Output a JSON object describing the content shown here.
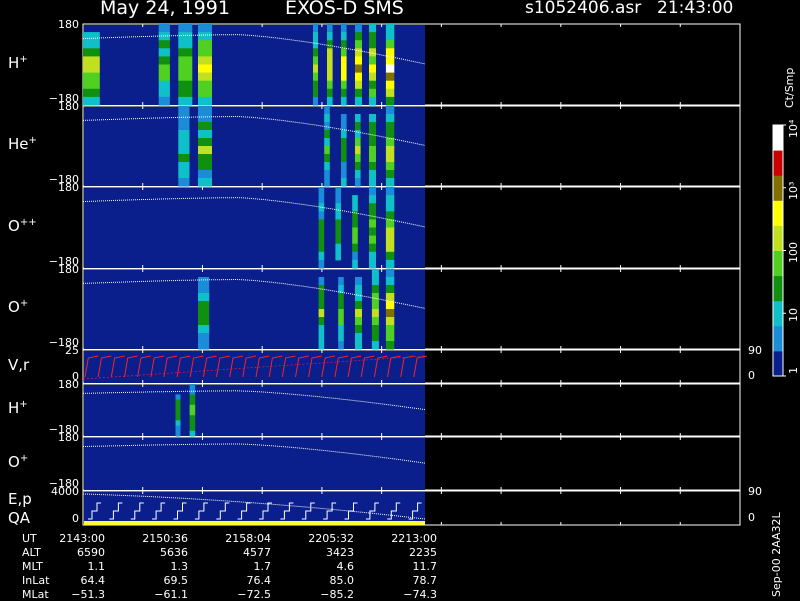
{
  "header": {
    "date_title": "May 24, 1991",
    "instrument": "EXOS-D SMS",
    "filename": "s1052406.asr",
    "time": "21:43:00"
  },
  "colors": {
    "background": "#000000",
    "panel_bg": "#0a1e8c",
    "axis": "#ffffff",
    "velocity_trace": "#ff2020",
    "energy_trace": "#ffffff",
    "qa_bar": "#ffff33"
  },
  "colorbar": {
    "unit": "Ct/Smp",
    "tick_labels": [
      "1",
      "10",
      "100",
      "10³",
      "10⁴"
    ],
    "tick_values": [
      1,
      10,
      100,
      1000,
      10000
    ],
    "colors": [
      "#0a1e8c",
      "#1a8cd8",
      "#10c0c8",
      "#109010",
      "#50d020",
      "#c0e020",
      "#ffff00",
      "#807000",
      "#cc0000",
      "#ffffff"
    ]
  },
  "panels": [
    {
      "label": "H",
      "sup": "+",
      "ymax": "180",
      "ymin": "−180"
    },
    {
      "label": "He",
      "sup": "+",
      "ymax": "180",
      "ymin": "−180"
    },
    {
      "label": "O",
      "sup": "++",
      "ymax": "180",
      "ymin": "−180"
    },
    {
      "label": "O",
      "sup": "+",
      "ymax": "180",
      "ymin": "−180"
    },
    {
      "label": "V,r",
      "sup": "",
      "ymax": "25",
      "ymin": "0",
      "rmax": "90",
      "rmin": "0"
    },
    {
      "label": "H",
      "sup": "+",
      "ymax": "180",
      "ymin": "−180"
    },
    {
      "label": "O",
      "sup": "+",
      "ymax": "180",
      "ymin": "−180"
    },
    {
      "label": "E,p",
      "sup": "",
      "label2": "QA",
      "ymax": "4000",
      "ymin": "0",
      "rmax": "90",
      "rmin": "0"
    }
  ],
  "side_note": "Sep-00  2AA32L",
  "chart_data": {
    "type": "heatmap",
    "title": "May 24, 1991   EXOS-D SMS",
    "xlabel": "UT",
    "x_ticks": [
      "2143:00",
      "2150:36",
      "2158:04",
      "2205:32",
      "2213:00"
    ],
    "ephemeris": [
      {
        "name": "UT",
        "values": [
          "2143:00",
          "2150:36",
          "2158:04",
          "2205:32",
          "2213:00"
        ]
      },
      {
        "name": "ALT",
        "values": [
          "6590",
          "5636",
          "4577",
          "3423",
          "2235"
        ]
      },
      {
        "name": "MLT",
        "values": [
          "1.1",
          "1.3",
          "1.7",
          "4.6",
          "11.7"
        ]
      },
      {
        "name": "InLat",
        "values": [
          "64.4",
          "69.5",
          "76.4",
          "85.0",
          "78.7"
        ]
      },
      {
        "name": "MLat",
        "values": [
          "−51.3",
          "−61.1",
          "−72.5",
          "−85.2",
          "−74.3"
        ]
      }
    ],
    "colorscale": {
      "unit": "Ct/Smp",
      "range": [
        1,
        10000
      ],
      "log": true
    },
    "data_coverage_end_ut": "2213:00",
    "series": [
      {
        "name": "H+",
        "ylim": [
          -180,
          180
        ],
        "bursts": [
          {
            "t": 0.0,
            "dt": 0.06,
            "peak": 5
          },
          {
            "t": 0.27,
            "dt": 0.04,
            "peak": 4
          },
          {
            "t": 0.34,
            "dt": 0.05,
            "peak": 4
          },
          {
            "t": 0.41,
            "dt": 0.05,
            "peak": 6
          },
          {
            "t": 0.82,
            "dt": 0.018,
            "peak": 5
          },
          {
            "t": 0.87,
            "dt": 0.02,
            "peak": 6
          },
          {
            "t": 0.92,
            "dt": 0.02,
            "peak": 6
          },
          {
            "t": 0.97,
            "dt": 0.025,
            "peak": 7
          },
          {
            "t": 1.02,
            "dt": 0.025,
            "peak": 6
          },
          {
            "t": 1.08,
            "dt": 0.03,
            "peak": 8
          }
        ]
      },
      {
        "name": "He+",
        "ylim": [
          -180,
          180
        ],
        "bursts": [
          {
            "t": 0.34,
            "dt": 0.04,
            "peak": 3
          },
          {
            "t": 0.41,
            "dt": 0.05,
            "peak": 4
          },
          {
            "t": 0.86,
            "dt": 0.02,
            "peak": 3
          },
          {
            "t": 0.92,
            "dt": 0.02,
            "peak": 3
          },
          {
            "t": 0.97,
            "dt": 0.02,
            "peak": 4
          },
          {
            "t": 1.02,
            "dt": 0.025,
            "peak": 4
          },
          {
            "t": 1.08,
            "dt": 0.03,
            "peak": 5
          }
        ]
      },
      {
        "name": "O++",
        "ylim": [
          -180,
          180
        ],
        "bursts": [
          {
            "t": 0.84,
            "dt": 0.02,
            "peak": 3
          },
          {
            "t": 0.9,
            "dt": 0.02,
            "peak": 3
          },
          {
            "t": 0.96,
            "dt": 0.02,
            "peak": 4
          },
          {
            "t": 1.02,
            "dt": 0.025,
            "peak": 4
          },
          {
            "t": 1.08,
            "dt": 0.03,
            "peak": 6
          }
        ]
      },
      {
        "name": "O+",
        "ylim": [
          -180,
          180
        ],
        "bursts": [
          {
            "t": 0.41,
            "dt": 0.04,
            "peak": 3
          },
          {
            "t": 0.84,
            "dt": 0.02,
            "peak": 4
          },
          {
            "t": 0.91,
            "dt": 0.02,
            "peak": 4
          },
          {
            "t": 0.97,
            "dt": 0.025,
            "peak": 4
          },
          {
            "t": 1.03,
            "dt": 0.025,
            "peak": 5
          },
          {
            "t": 1.08,
            "dt": 0.03,
            "peak": 6
          }
        ]
      },
      {
        "name": "H+ (low)",
        "ylim": [
          -180,
          180
        ],
        "bursts": [
          {
            "t": 0.33,
            "dt": 0.015,
            "peak": 3
          },
          {
            "t": 0.38,
            "dt": 0.02,
            "peak": 4
          }
        ]
      },
      {
        "name": "O+ (low)",
        "ylim": [
          -180,
          180
        ],
        "bursts": []
      }
    ],
    "velocity_panel": {
      "ylim": [
        0,
        25
      ],
      "rlim": [
        0,
        90
      ],
      "sweeps": 26
    },
    "energy_panel": {
      "ylim": [
        0,
        4000
      ],
      "rlim": [
        0,
        90
      ],
      "sweeps": 16
    }
  }
}
